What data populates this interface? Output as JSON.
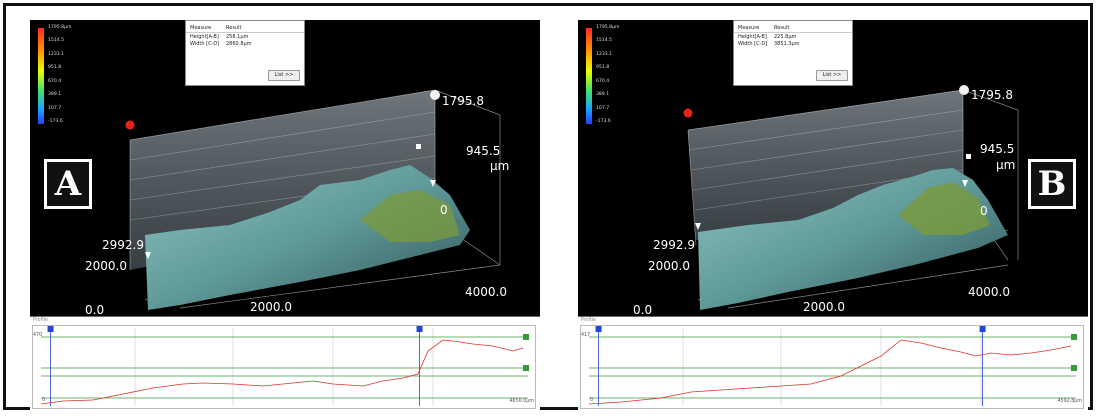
{
  "colorbar": {
    "labels": [
      "1795.8µm",
      "1514.5",
      "1233.1",
      "951.8",
      "670.4",
      "389.1",
      "107.7",
      "-173.6"
    ],
    "colors": [
      "#ff2a2a",
      "#ff9a00",
      "#eaff00",
      "#45e06b",
      "#1aa3ff",
      "#2a3cff"
    ]
  },
  "measure": {
    "col_measure": "Measure",
    "col_result": "Result",
    "list_button": "List >>"
  },
  "axes": {
    "z_top": "1795.8",
    "z_mid": "945.5",
    "z_unit": "µm",
    "z_low_partial": "0",
    "y_top": "2992.9",
    "y_mid": "2000.0",
    "y_low_partial": "0.0",
    "x_mid": "2000.0",
    "x_right": "4000.0"
  },
  "profile_title": "Profile",
  "panels": [
    {
      "badge": "A",
      "rows": [
        {
          "name": "Height[A-B]",
          "value": "258.1µm"
        },
        {
          "name": "Width [C-D]",
          "value": "2860.8µm"
        }
      ],
      "profile_ymax": "470",
      "profile_x0": "0",
      "profile_xmax": "4650.0µm",
      "markers": {
        "start_x": 0.035,
        "end_x": 0.77
      }
    },
    {
      "badge": "B",
      "rows": [
        {
          "name": "Height[A-B]",
          "value": "225.8µm"
        },
        {
          "name": "Width [C-D]",
          "value": "3851.3µm"
        }
      ],
      "profile_ymax": "417",
      "profile_x0": "0",
      "profile_xmax": "4592.8µm",
      "markers": {
        "start_x": 0.035,
        "end_x": 0.8
      }
    }
  ],
  "colors": {
    "curve": "#e0302a",
    "marker": "#2346d8",
    "guide": "#3c9a3c",
    "badge_bg": "#111111",
    "badge_border": "#ffffff"
  }
}
